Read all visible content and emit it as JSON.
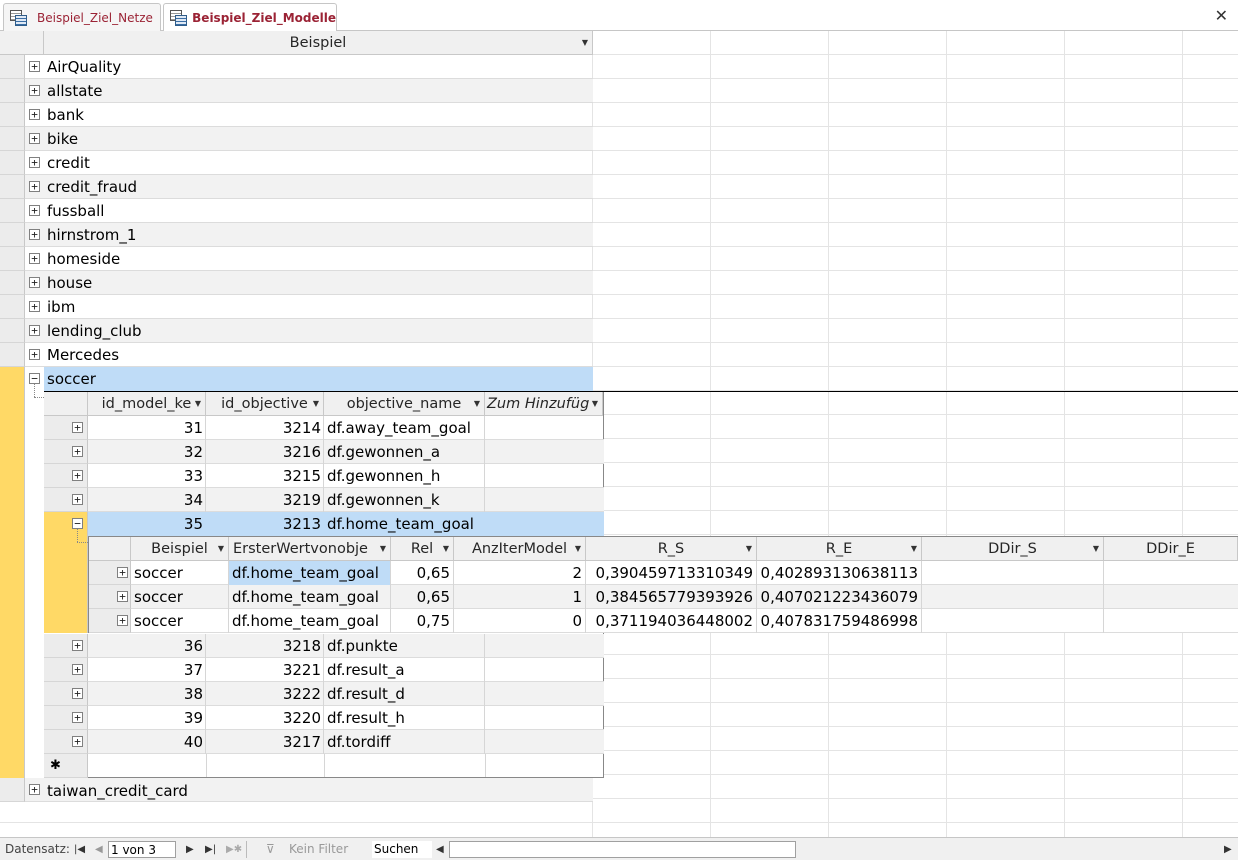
{
  "tabs": [
    {
      "label": "Beispiel_Ziel_Netze",
      "active": false
    },
    {
      "label": "Beispiel_Ziel_Modelle",
      "active": true
    }
  ],
  "close_glyph": "✕",
  "outer_header": "Beispiel",
  "outer_rows": [
    "AirQuality",
    "allstate",
    "bank",
    "bike",
    "credit",
    "credit_fraud",
    "fussball",
    "hirnstrom_1",
    "homeside",
    "house",
    "ibm",
    "lending_club",
    "Mercedes",
    "soccer",
    "taiwan_credit_card"
  ],
  "sub_headers": [
    "id_model_ke",
    "id_objective",
    "objective_name",
    "Zum Hinzufüg"
  ],
  "sub_rows": [
    [
      "31",
      "3214",
      "df.away_team_goal"
    ],
    [
      "32",
      "3216",
      "df.gewonnen_a"
    ],
    [
      "33",
      "3215",
      "df.gewonnen_h"
    ],
    [
      "34",
      "3219",
      "df.gewonnen_k"
    ],
    [
      "35",
      "3213",
      "df.home_team_goal"
    ],
    [
      "36",
      "3218",
      "df.punkte"
    ],
    [
      "37",
      "3221",
      "df.result_a"
    ],
    [
      "38",
      "3222",
      "df.result_d"
    ],
    [
      "39",
      "3220",
      "df.result_h"
    ],
    [
      "40",
      "3217",
      "df.tordiff"
    ]
  ],
  "new_row_glyph": "✱",
  "inner_headers": [
    "Beispiel",
    "ErsterWertvonobje",
    "Rel",
    "AnzIterModel",
    "R_S",
    "R_E",
    "DDir_S",
    "DDir_E"
  ],
  "inner_rows": [
    [
      "soccer",
      "df.home_team_goal",
      "0,65",
      "2",
      "0,390459713310349",
      "0,402893130638113"
    ],
    [
      "soccer",
      "df.home_team_goal",
      "0,65",
      "1",
      "0,384565779393926",
      "0,407021223436079"
    ],
    [
      "soccer",
      "df.home_team_goal",
      "0,75",
      "0",
      "0,371194036448002",
      "0,407831759486998"
    ]
  ],
  "statusbar": {
    "label": "Datensatz:",
    "record": "1 von 3",
    "filter": "Kein Filter",
    "search": "Suchen"
  },
  "colors": {
    "selection": "#ffd966",
    "highlight": "#bfdcf7",
    "tab_text": "#9b2335"
  }
}
